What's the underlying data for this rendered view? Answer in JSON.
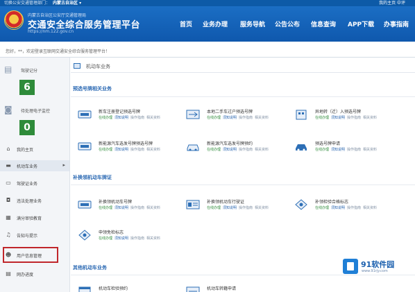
{
  "topbar": {
    "left": "切换公安交通管理部门：",
    "region": "内蒙古自治区 ▾",
    "right": "我的主页  中评"
  },
  "header": {
    "subtitle": "内蒙古自治区公安厅交通管理局",
    "title": "交通安全综合服务管理平台",
    "url": "https://nm.122.gov.cn",
    "nav": [
      "首页",
      "业务办理",
      "服务导航",
      "公告公布",
      "信息查询",
      "APP下载",
      "办事指南"
    ]
  },
  "welcome": "您好，**，欢迎登录互联网交通安全综合服务管理平台！",
  "sidebar": {
    "stats": [
      {
        "label": "驾驶记分",
        "value": "6",
        "icon": "score-icon"
      },
      {
        "label": "待处理电子监控",
        "value": "0",
        "icon": "camera-icon"
      }
    ],
    "menu": [
      {
        "label": "我的主页",
        "icon": "home-icon"
      },
      {
        "label": "机动车业务",
        "icon": "car-icon",
        "arrow": "▸"
      },
      {
        "label": "驾驶证业务",
        "icon": "license-icon"
      },
      {
        "label": "违法处理业务",
        "icon": "camera-icon"
      },
      {
        "label": "满分审验教育",
        "icon": "education-icon"
      },
      {
        "label": "告知与提示",
        "icon": "bell-icon"
      },
      {
        "label": "用户信息管理",
        "icon": "user-icon"
      },
      {
        "label": "网办进度",
        "icon": "progress-icon"
      }
    ]
  },
  "main": {
    "module_title": "机动车业务",
    "sections": [
      {
        "title": "预选号牌相关业务",
        "items": [
          {
            "name": "新车注册登记预选号牌"
          },
          {
            "name": "本地二手车过户预选号牌"
          },
          {
            "name": "异地转（迁）入预选号牌"
          },
          {
            "name": "新能源汽车选发号牌预选号牌"
          },
          {
            "name": "新能源汽车选发号牌预约"
          },
          {
            "name": "预选号牌申请"
          }
        ]
      },
      {
        "title": "补换领机动车牌证",
        "items": [
          {
            "name": "补换领机动车号牌"
          },
          {
            "name": "补换领机动车行驶证"
          },
          {
            "name": "补领检验合格标志"
          },
          {
            "name": "申领免检标志"
          }
        ]
      },
      {
        "title": "其他机动车业务",
        "items": [
          {
            "name": "机动车检验预约"
          },
          {
            "name": "机动车转籍申请"
          }
        ]
      }
    ],
    "actions": {
      "online": "在线办理",
      "notice": "须知说明",
      "flow": "操作指南",
      "data": "相关资料"
    }
  },
  "watermark": {
    "name": "91软件园",
    "url": "www.91rjy.com"
  },
  "colors": {
    "header_blue": "#0f58ad",
    "stat_green": "#2e8b3a",
    "section_blue": "#2b69b3",
    "highlight_red": "#c0262b"
  }
}
